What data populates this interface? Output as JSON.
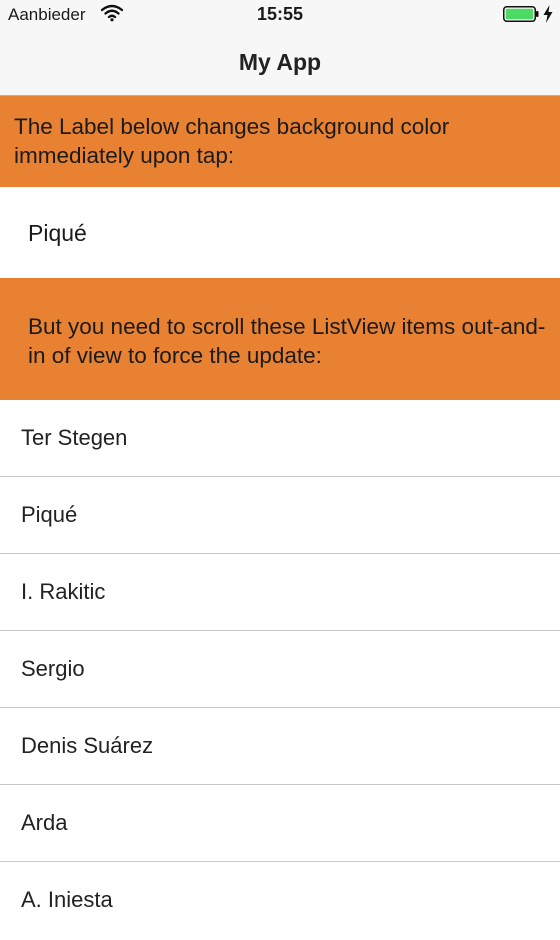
{
  "status": {
    "carrier": "Aanbieder",
    "time": "15:55",
    "wifi_icon": "wifi-icon",
    "battery_icon": "battery-icon",
    "charging_icon": "charging-bolt-icon",
    "battery_color": "#4cd964"
  },
  "nav": {
    "title": "My App"
  },
  "banner1": {
    "text": "The Label below changes background color immediately upon tap:"
  },
  "tap_label": {
    "text": "Piqué"
  },
  "banner2": {
    "text": "But you need to scroll these ListView items out-and-in of view to force the update:"
  },
  "list": {
    "items": [
      {
        "label": "Ter Stegen"
      },
      {
        "label": "Piqué"
      },
      {
        "label": "I. Rakitic"
      },
      {
        "label": "Sergio"
      },
      {
        "label": "Denis Suárez"
      },
      {
        "label": "Arda"
      },
      {
        "label": "A. Iniesta"
      }
    ]
  },
  "colors": {
    "accent": "#e98132",
    "separator": "#c8c7cc",
    "bar": "#f7f7f7"
  }
}
